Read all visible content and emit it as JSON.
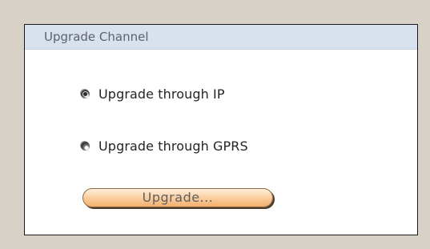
{
  "panel": {
    "title": "Upgrade Channel"
  },
  "options": [
    {
      "label": "Upgrade through IP",
      "checked": true
    },
    {
      "label": "Upgrade through GPRS",
      "checked": false
    }
  ],
  "actions": {
    "upgrade_label": "Upgrade..."
  },
  "colors": {
    "page_background": "#d8d1c8",
    "header_background": "#d8e2ee",
    "button_gradient_top": "#fff0dc",
    "button_gradient_bottom": "#f3af6d"
  }
}
